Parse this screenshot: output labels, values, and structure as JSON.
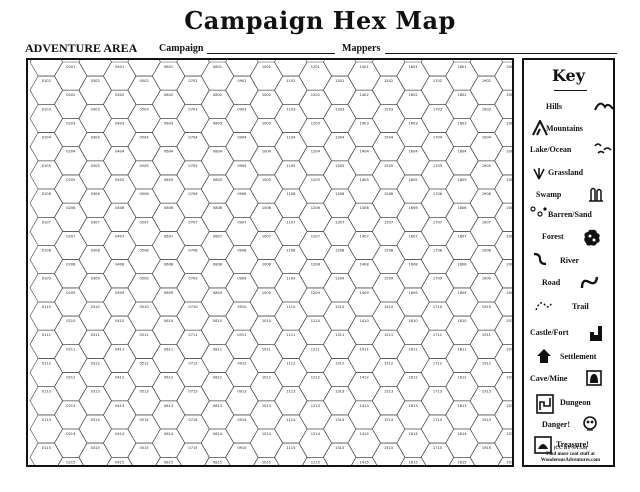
{
  "title": "Campaign Hex Map",
  "header": {
    "area_label": "ADVENTURE AREA",
    "campaign_label": "Campaign",
    "mappers_label": "Mappers"
  },
  "key": {
    "title": "Key",
    "items": [
      {
        "label": "Hills",
        "icon": "hills-icon"
      },
      {
        "label": "Mountains",
        "icon": "mountains-icon"
      },
      {
        "label": "Lake/Ocean",
        "icon": "lake-ocean-icon"
      },
      {
        "label": "Grassland",
        "icon": "grassland-icon"
      },
      {
        "label": "Swamp",
        "icon": "swamp-icon"
      },
      {
        "label": "Barren/Sand",
        "icon": "barren-sand-icon"
      },
      {
        "label": "Forest",
        "icon": "forest-icon"
      },
      {
        "label": "River",
        "icon": "river-icon"
      },
      {
        "label": "Road",
        "icon": "road-icon"
      },
      {
        "label": "Trail",
        "icon": "trail-icon"
      },
      {
        "label": "Castle/Fort",
        "icon": "castle-fort-icon"
      },
      {
        "label": "Settlement",
        "icon": "settlement-icon"
      },
      {
        "label": "Cave/Mine",
        "icon": "cave-mine-icon"
      },
      {
        "label": "Dungeon",
        "icon": "dungeon-icon"
      },
      {
        "label": "Danger!",
        "icon": "danger-icon"
      },
      {
        "label": "Treasure!",
        "icon": "treasure-icon"
      }
    ],
    "credits": [
      "(CC BY-SA 3.0)",
      "Find more cool stuff at",
      "WonderousAdventures.com"
    ]
  },
  "map": {
    "column_numbers": [
      "01",
      "02",
      "03",
      "04",
      "05",
      "06",
      "07",
      "08",
      "09",
      "10",
      "11",
      "12",
      "13",
      "14",
      "15",
      "16",
      "17",
      "18",
      "19",
      "20"
    ],
    "row_numbers": [
      "01",
      "02",
      "03",
      "04",
      "05",
      "06",
      "07",
      "08",
      "09",
      "10",
      "11",
      "12",
      "13",
      "14",
      "15",
      "16",
      "17",
      "18",
      "19",
      "20",
      "21",
      "22",
      "23",
      "24",
      "25"
    ]
  }
}
